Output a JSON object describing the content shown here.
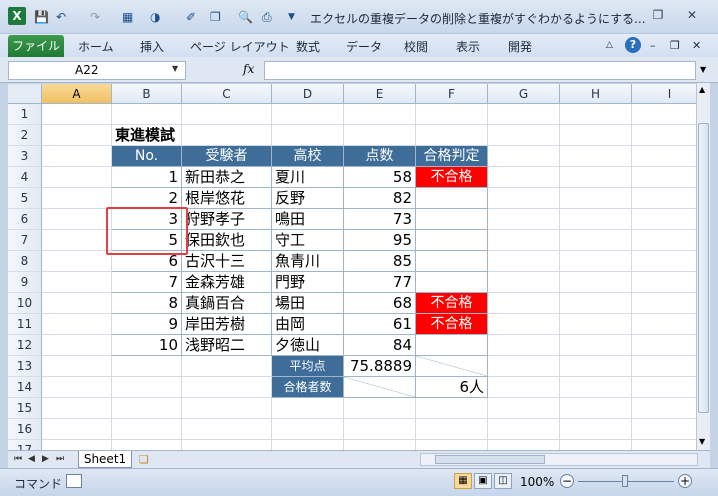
{
  "window": {
    "title": "エクセルの重複データの削除と重複がすぐわかるようにする...",
    "controls": {
      "help": "?",
      "minimize": "–",
      "restore": "❐",
      "close": "✕"
    }
  },
  "ribbon": {
    "file_tab": "ファイル",
    "tabs": [
      "ホーム",
      "挿入",
      "ページ レイアウト",
      "数式",
      "データ",
      "校閲",
      "表示",
      "開発"
    ]
  },
  "formula_bar": {
    "name_box": "A22",
    "fx": "fx",
    "formula": ""
  },
  "columns": [
    "A",
    "B",
    "C",
    "D",
    "E",
    "F",
    "G",
    "H",
    "I"
  ],
  "rows": [
    "1",
    "2",
    "3",
    "4",
    "5",
    "6",
    "7",
    "8",
    "9",
    "10",
    "11",
    "12",
    "13",
    "14",
    "15",
    "16",
    "17"
  ],
  "sheet": {
    "title": "東進模試",
    "headers": [
      "No.",
      "受験者",
      "高校",
      "点数",
      "合格判定"
    ],
    "records": [
      {
        "no": "1",
        "name": "新田恭之",
        "school": "夏川",
        "score": "58",
        "result": "不合格"
      },
      {
        "no": "2",
        "name": "根岸悠花",
        "school": "反野",
        "score": "82",
        "result": ""
      },
      {
        "no": "3",
        "name": "狩野孝子",
        "school": "鳴田",
        "score": "73",
        "result": ""
      },
      {
        "no": "5",
        "name": "保田欽也",
        "school": "守工",
        "score": "95",
        "result": ""
      },
      {
        "no": "6",
        "name": "古沢十三",
        "school": "魚青川",
        "score": "85",
        "result": ""
      },
      {
        "no": "7",
        "name": "金森芳雄",
        "school": "門野",
        "score": "77",
        "result": ""
      },
      {
        "no": "8",
        "name": "真鍋百合",
        "school": "場田",
        "score": "68",
        "result": "不合格"
      },
      {
        "no": "9",
        "name": "岸田芳樹",
        "school": "由岡",
        "score": "61",
        "result": "不合格"
      },
      {
        "no": "10",
        "name": "浅野昭二",
        "school": "夕徳山",
        "score": "84",
        "result": ""
      }
    ],
    "summary": {
      "avg_label": "平均点",
      "avg_value": "75.8889",
      "pass_label": "合格者数",
      "pass_value": "6人"
    }
  },
  "sheet_tabs": {
    "active": "Sheet1"
  },
  "status": {
    "mode": "コマンド",
    "zoom": "100%"
  },
  "colors": {
    "header_bg": "#3e6d99",
    "fail_bg": "#ff0000",
    "highlight_border": "#e34040"
  }
}
